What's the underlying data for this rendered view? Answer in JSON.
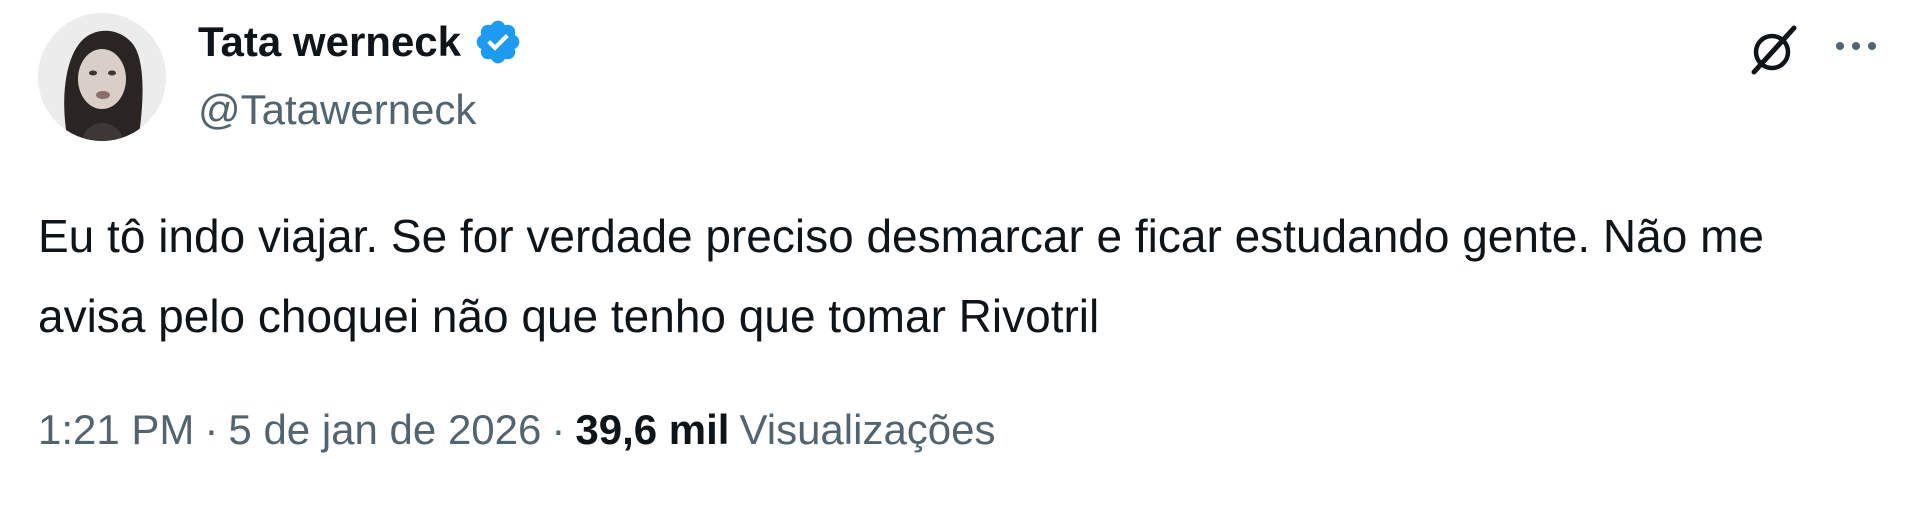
{
  "author": {
    "display_name": "Tata werneck",
    "handle": "@Tatawerneck",
    "verified": true,
    "verified_color": "#1d9bf0",
    "avatar_icon": "profile-photo"
  },
  "toolbar": {
    "grok_icon": "grok-icon",
    "more_icon": "more-options-icon"
  },
  "tweet": {
    "text": "Eu tô indo viajar. Se for verdade preciso desmarcar e ficar estudando gente. Não me avisa pelo choquei não que tenho que tomar Rivotril"
  },
  "meta": {
    "time": "1:21 PM",
    "separator": "·",
    "date": "5 de jan de 2026",
    "views_count": "39,6 mil",
    "views_label": "Visualizações"
  },
  "colors": {
    "text_primary": "#0f1419",
    "text_secondary": "#536471",
    "background": "#ffffff"
  }
}
